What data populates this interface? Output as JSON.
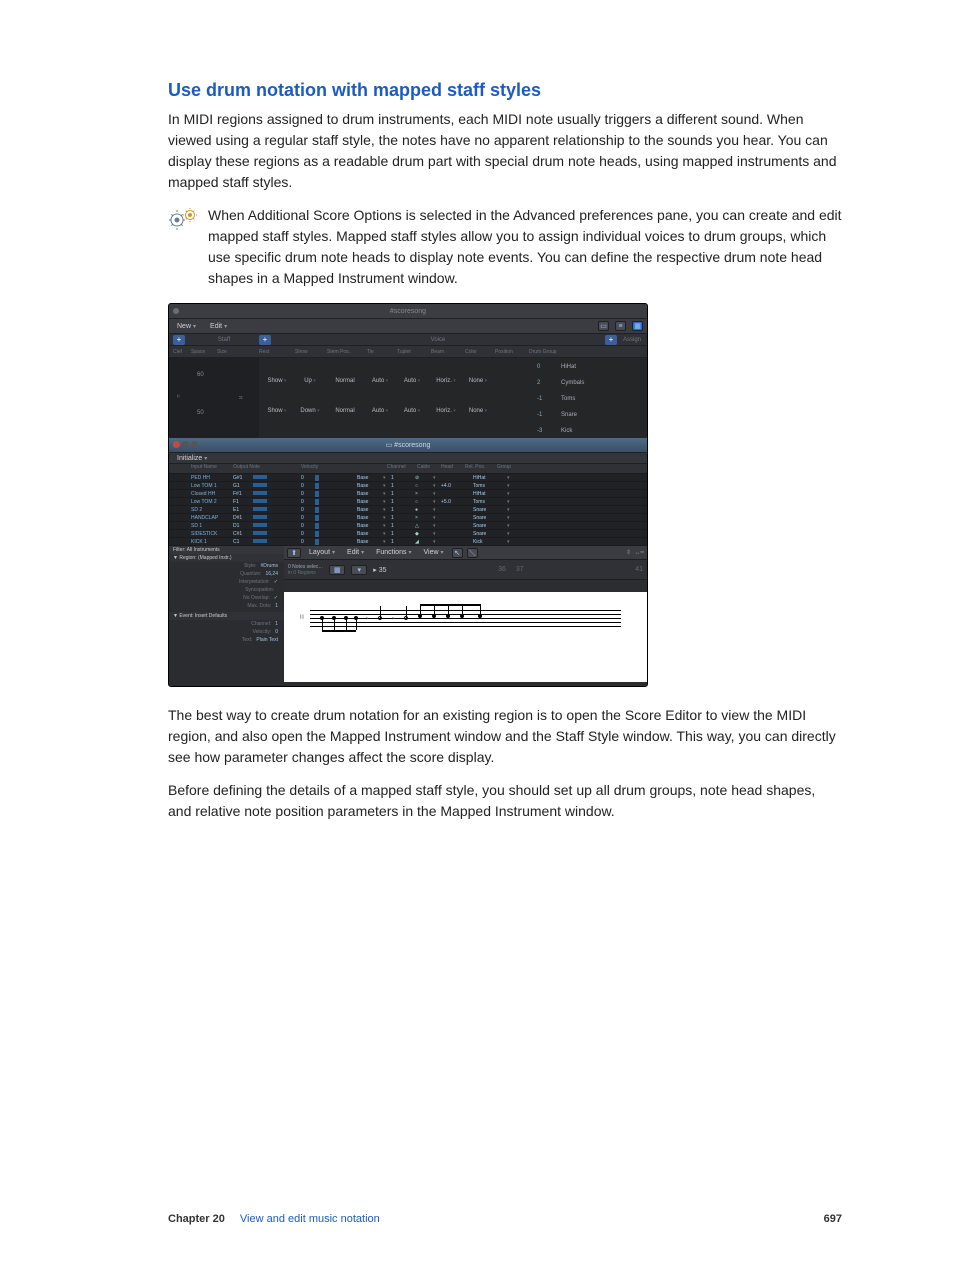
{
  "section": {
    "title": "Use drum notation with mapped staff styles",
    "para1": "In MIDI regions assigned to drum instruments, each MIDI note usually triggers a different sound. When viewed using a regular staff style, the notes have no apparent relationship to the sounds you hear. You can display these regions as a readable drum part with special drum note heads, using mapped instruments and mapped staff styles.",
    "para2": "When Additional Score Options is selected in the Advanced preferences pane, you can create and edit mapped staff styles. Mapped staff styles allow you to assign individual voices to drum groups, which use specific drum note heads to display note events. You can define the respective drum note head shapes in a Mapped Instrument window.",
    "para3": "The best way to create drum notation for an existing region is to open the Score Editor to view the MIDI region, and also open the Mapped Instrument window and the Staff Style window. This way, you can directly see how parameter changes affect the score display.",
    "para4": "Before defining the details of a mapped staff style, you should set up all drum groups, note head shapes, and relative note position parameters in the Mapped Instrument window."
  },
  "staff_style_window": {
    "title": "#scoresong",
    "menus": {
      "new": "New",
      "edit": "Edit"
    },
    "section_labels": {
      "staff": "Staff",
      "voice": "Voice",
      "assign": "Assign"
    },
    "columns": [
      "Clef",
      "Space",
      "Size",
      "Rest",
      "Show",
      "Stem Pos.",
      "Tie",
      "Tuplet",
      "Beam",
      "Color",
      "Position",
      "Drum Group"
    ],
    "left_marks": [
      "60",
      "50"
    ],
    "voices": [
      {
        "show": "Show",
        "stem": "Up",
        "norm": "Normal",
        "tie": "Auto",
        "tuplet": "Auto",
        "beam": "Horiz.",
        "color": "None"
      },
      {
        "show": "Show",
        "stem": "Down",
        "norm": "Normal",
        "tie": "Auto",
        "tuplet": "Auto",
        "beam": "Horiz.",
        "color": "None"
      }
    ],
    "drum_groups": [
      {
        "pos": "0",
        "name": "HiHat"
      },
      {
        "pos": "2",
        "name": "Cymbals"
      },
      {
        "pos": "-1",
        "name": "Toms"
      },
      {
        "pos": "-1",
        "name": "Snare"
      },
      {
        "pos": "-3",
        "name": "Kick"
      }
    ]
  },
  "mapped_instrument_window": {
    "title": "#scoresong",
    "init_label": "Initialize",
    "columns": [
      "",
      "Input Name",
      "Output Note",
      "",
      "Velocity",
      "",
      "Channel",
      "Cable",
      "Head",
      "Rel. Pos.",
      "Group",
      ""
    ],
    "rows": [
      {
        "name": "PED HH",
        "out": "G#1",
        "vel": "0",
        "chan": "Base",
        "cable": "1",
        "head": "⊘",
        "rel": "",
        "group": "HiHat"
      },
      {
        "name": "Low TOM 1",
        "out": "G1",
        "vel": "0",
        "chan": "Base",
        "cable": "1",
        "head": "○",
        "rel": "+4.0",
        "group": "Toms"
      },
      {
        "name": "Closed HH",
        "out": "F#1",
        "vel": "0",
        "chan": "Base",
        "cable": "1",
        "head": "×",
        "rel": "",
        "group": "HiHat"
      },
      {
        "name": "Low TOM 2",
        "out": "F1",
        "vel": "0",
        "chan": "Base",
        "cable": "1",
        "head": "○",
        "rel": "+5.0",
        "group": "Toms"
      },
      {
        "name": "SD 2",
        "out": "E1",
        "vel": "0",
        "chan": "Base",
        "cable": "1",
        "head": "●",
        "rel": "",
        "group": "Snare"
      },
      {
        "name": "HANDCLAP",
        "out": "D#1",
        "vel": "0",
        "chan": "Base",
        "cable": "1",
        "head": "×",
        "rel": "",
        "group": "Snare"
      },
      {
        "name": "SD 1",
        "out": "D1",
        "vel": "0",
        "chan": "Base",
        "cable": "1",
        "head": "△",
        "rel": "",
        "group": "Snare"
      },
      {
        "name": "SIDESTICK",
        "out": "C#1",
        "vel": "0",
        "chan": "Base",
        "cable": "1",
        "head": "◆",
        "rel": "",
        "group": "Snare"
      },
      {
        "name": "KICK 1",
        "out": "C1",
        "vel": "0",
        "chan": "Base",
        "cable": "1",
        "head": "◢",
        "rel": "",
        "group": "Kick"
      }
    ]
  },
  "score_panel": {
    "filter": "Filter: All Instruments",
    "toolbar": {
      "layout": "Layout",
      "edit": "Edit",
      "functions": "Functions",
      "view": "View"
    },
    "sel_info": {
      "notes": "0 Notes selec…",
      "regions": "in 0 Regions"
    },
    "ruler": {
      "start": "35",
      "marks": [
        "36",
        "37"
      ],
      "end": "41"
    },
    "region_box": {
      "title": "▼ Region: (Mapped Instr.)",
      "rows": [
        {
          "lab": "Style:",
          "val": "#Drums"
        },
        {
          "lab": "Quantize:",
          "val": "16,24"
        },
        {
          "lab": "Interpretation:",
          "val": "✓"
        },
        {
          "lab": "Syncopation:",
          "val": ""
        },
        {
          "lab": "No Overlap:",
          "val": "✓"
        },
        {
          "lab": "Max. Dots:",
          "val": "1"
        }
      ]
    },
    "event_box": {
      "title": "▼ Event: Insert Defaults",
      "rows": [
        {
          "lab": "Channel:",
          "val": "1"
        },
        {
          "lab": "Velocity:",
          "val": "0"
        },
        {
          "lab": "Text:",
          "val": "Plain Text"
        }
      ]
    }
  },
  "footer": {
    "chapter_label": "Chapter 20",
    "chapter_name": "View and edit music notation",
    "page": "697"
  }
}
